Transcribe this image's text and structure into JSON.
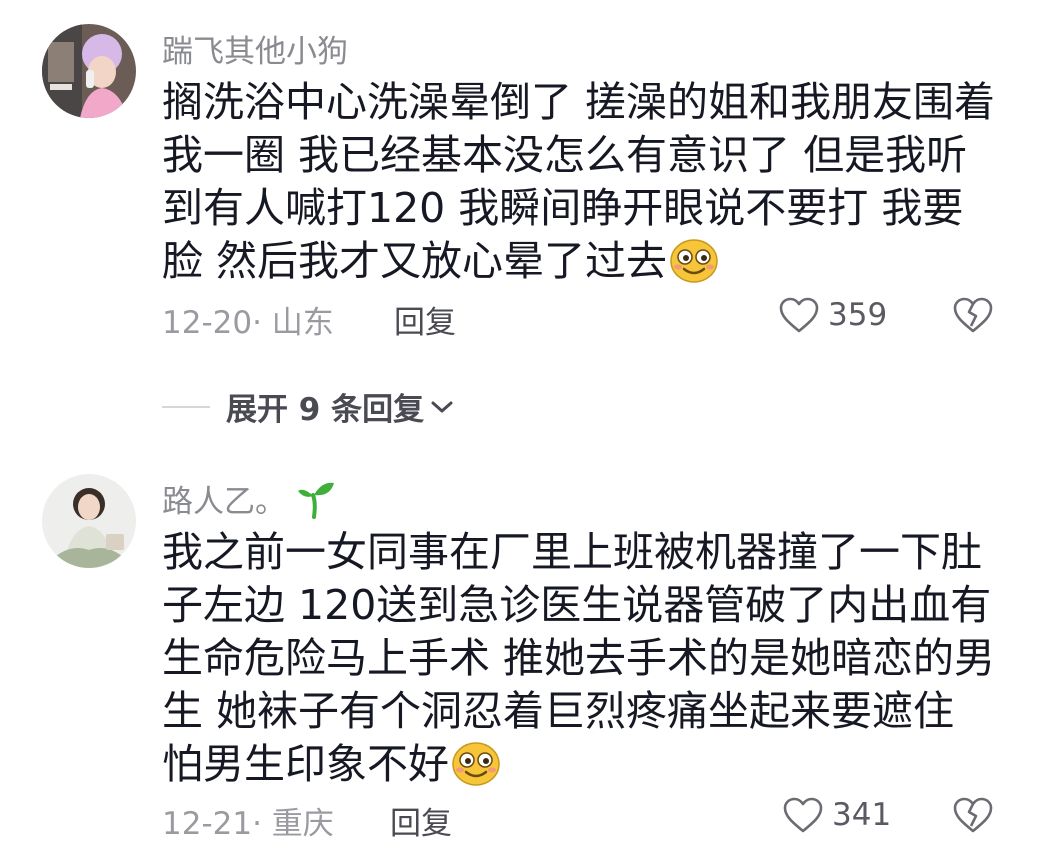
{
  "comments": [
    {
      "username": "踹飞其他小狗",
      "text": "搁洗浴中心洗澡晕倒了 搓澡的姐和我朋友围着我一圈 我已经基本没怎么有意识了 但是我听到有人喊打120 我瞬间睁开眼说不要打 我要脸 然后我才又放心晕了过去",
      "emoji": "smile-emoji",
      "meta": "12-20· 山东",
      "reply_label": "回复",
      "likes": "359",
      "avatar_icon": "avatar-girl-icon"
    },
    {
      "username": "路人乙。",
      "badge_icon": "sprout-icon",
      "text": "我之前一女同事在厂里上班被机器撞了一下肚子左边 120送到急诊医生说器管破了内出血有生命危险马上手术 推她去手术的是她暗恋的男生 她袜子有个洞忍着巨烈疼痛坐起来要遮住 怕男生印象不好",
      "emoji": "smile-emoji",
      "meta": "12-21· 重庆",
      "reply_label": "回复",
      "likes": "341",
      "avatar_icon": "avatar-woman-icon"
    }
  ],
  "expand_replies": {
    "label": "展开 9 条回复",
    "icon": "chevron-down-icon"
  },
  "colors": {
    "text": "#161823",
    "meta": "#9a9ba1",
    "sprout": "#3fae3a",
    "emoji": "#f6c53a"
  }
}
